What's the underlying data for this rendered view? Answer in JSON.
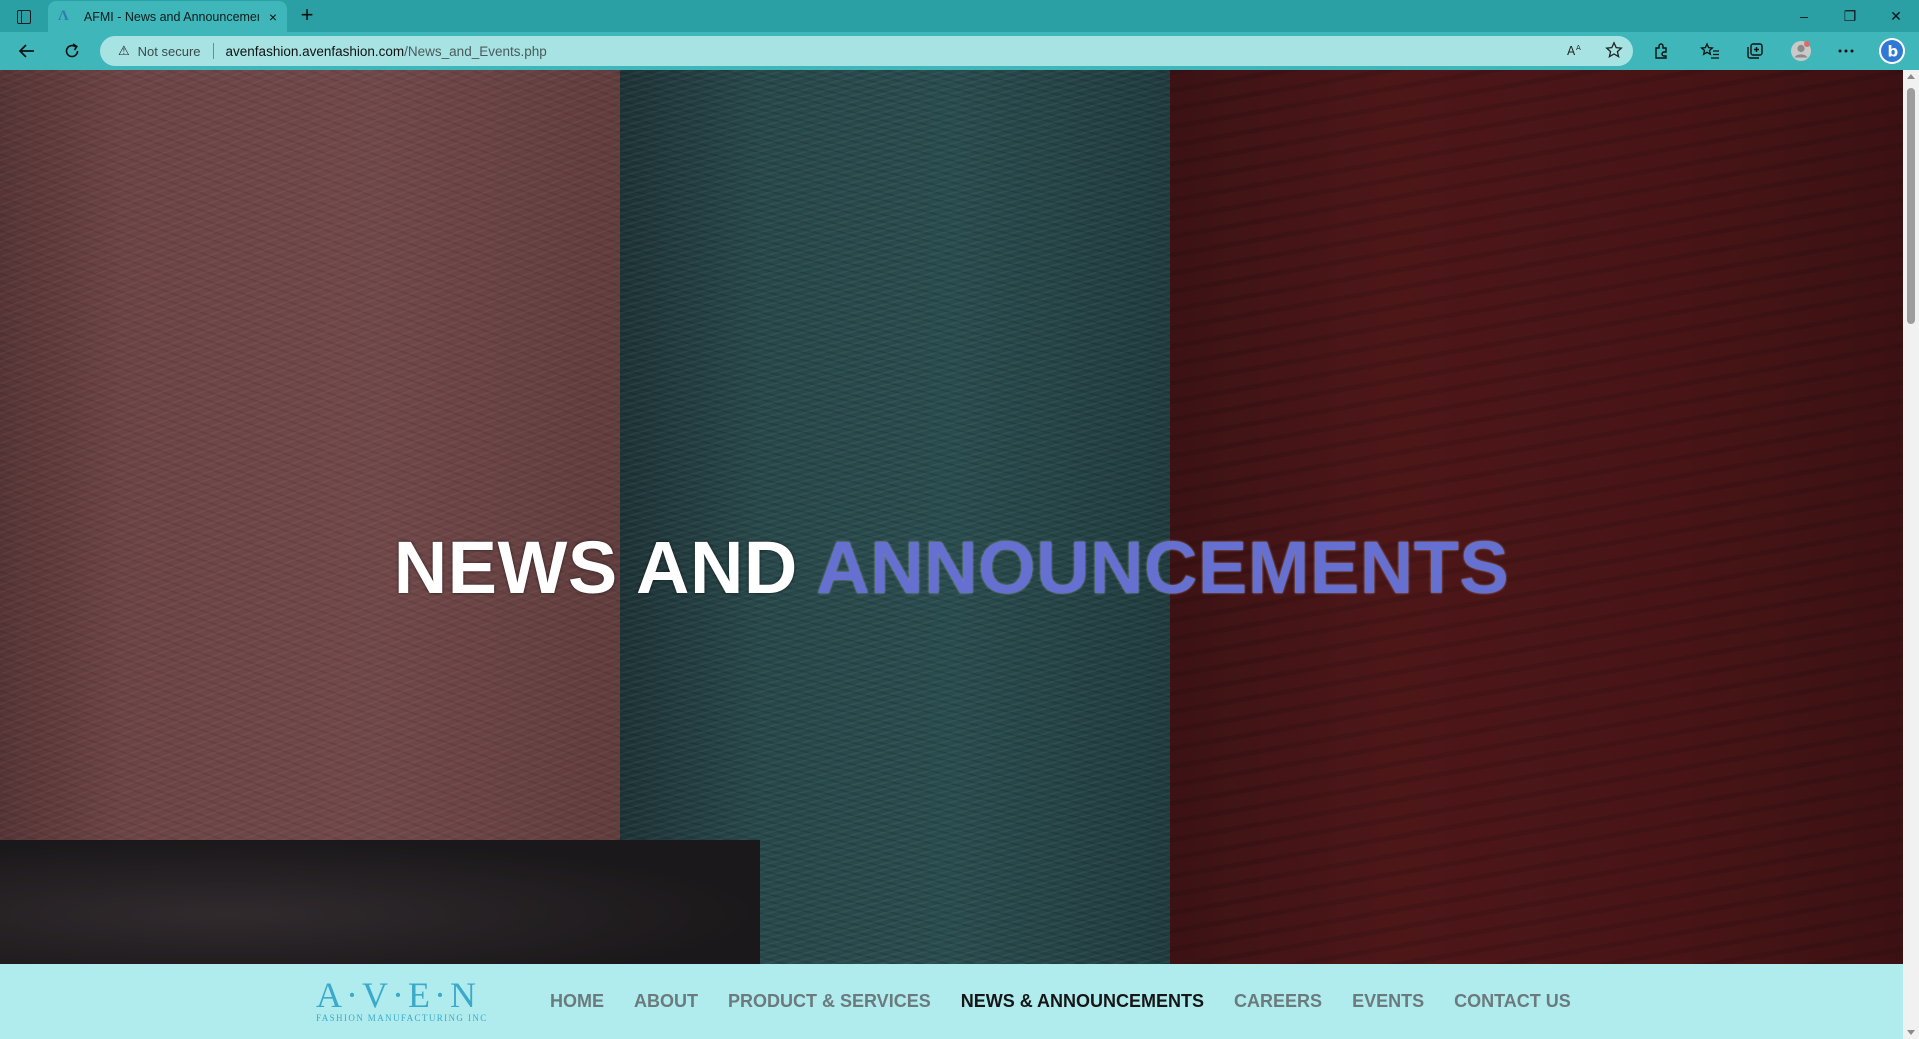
{
  "browser": {
    "tab": {
      "favicon": "Λ",
      "title": "AFMI - News and Announcements",
      "close_icon": "×"
    },
    "new_tab_icon": "+",
    "window_controls": {
      "minimize": "–",
      "restore": "❐",
      "close": "✕"
    },
    "address": {
      "warning_icon": "⚠",
      "security_label": "Not secure",
      "host": "avenfashion.avenfashion.com",
      "path": "/News_and_Events.php"
    },
    "toolbar_icons": [
      "back-icon",
      "refresh-icon",
      "read-aloud-icon",
      "favorite-star-icon",
      "extensions-icon",
      "favorites-icon",
      "collections-icon",
      "profile-icon",
      "more-icon",
      "bing-icon"
    ]
  },
  "hero": {
    "title_part1": "NEWS AND",
    "title_part2": "ANNOUNCEMENTS",
    "colors": {
      "white": "#ffffff",
      "accent": "#6670d0"
    }
  },
  "brand": {
    "logo_mark": "A·V·E·N",
    "logo_sub": "FASHION MANUFACTURING INC",
    "color": "#3ba9c9"
  },
  "nav": {
    "items": [
      {
        "label": "HOME",
        "active": false
      },
      {
        "label": "ABOUT",
        "active": false
      },
      {
        "label": "PRODUCT & SERVICES",
        "active": false
      },
      {
        "label": "NEWS & ANNOUNCEMENTS",
        "active": true
      },
      {
        "label": "CAREERS",
        "active": false
      },
      {
        "label": "EVENTS",
        "active": false
      },
      {
        "label": "CONTACT US",
        "active": false
      }
    ],
    "background": "#b0eced"
  }
}
